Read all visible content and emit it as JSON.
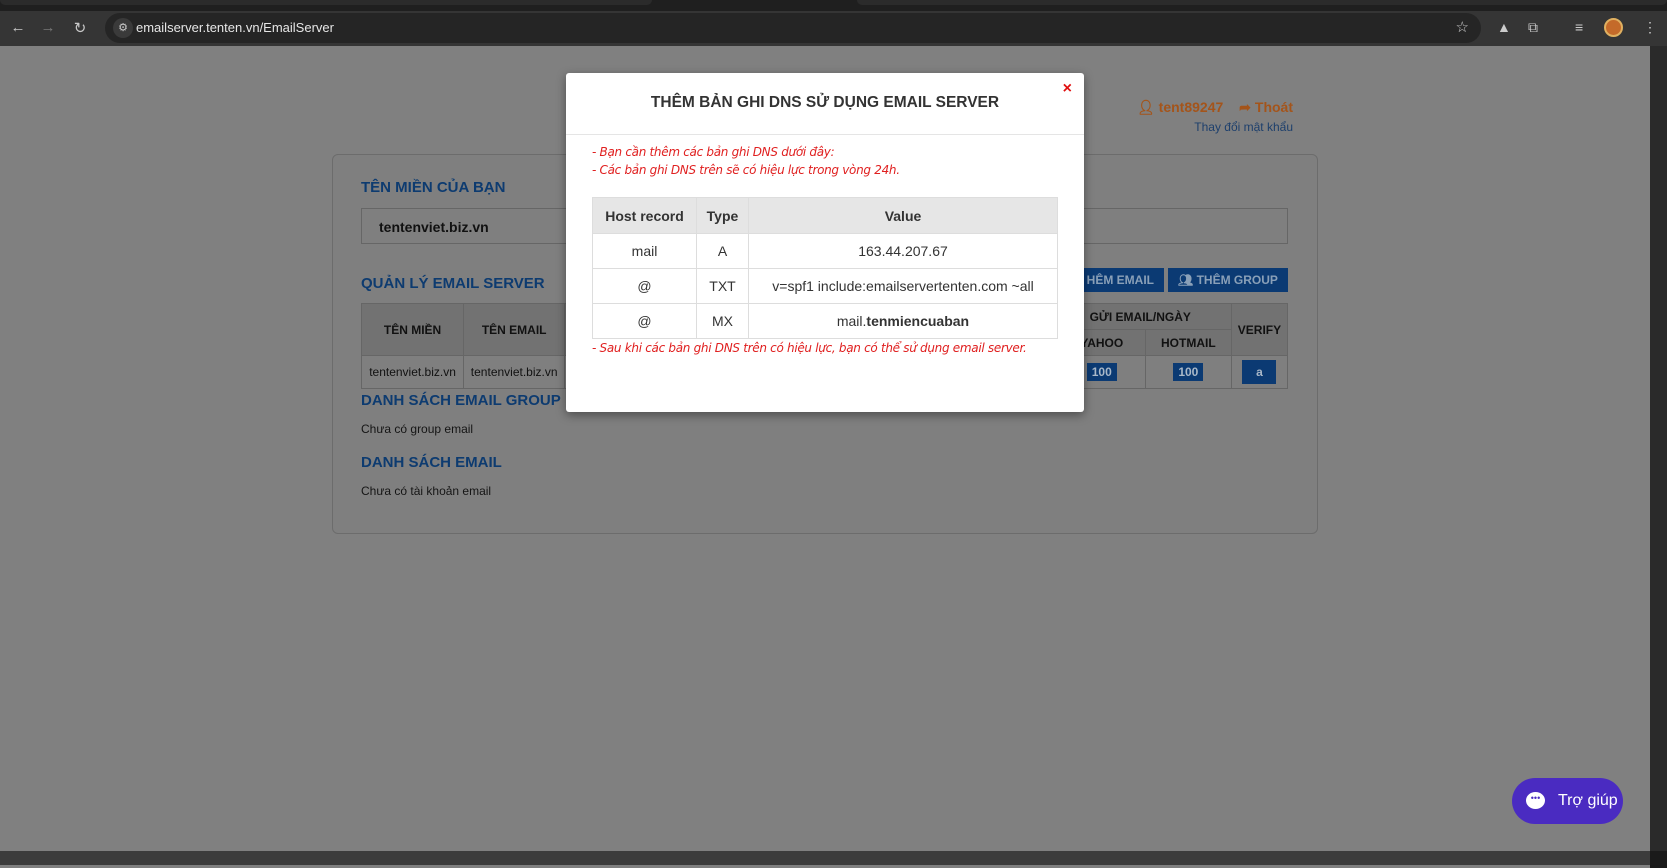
{
  "browser": {
    "url": "emailserver.tenten.vn/EmailServer"
  },
  "header": {
    "username": "tent89247",
    "logout": "Thoát",
    "change_password": "Thay đổi mật khẩu"
  },
  "domain_section": {
    "title": "TÊN MIỀN CỦA BẠN",
    "domain": "tentenviet.biz.vn"
  },
  "manage_section": {
    "title": "QUẢN LÝ EMAIL SERVER",
    "add_email_button": "HÊM EMAIL",
    "add_group_button": "THÊM GROUP",
    "columns": {
      "domain": "TÊN MIỀN",
      "email": "TÊN EMAIL",
      "send_per_day": "GỬI EMAIL/NGÀY",
      "yahoo": "YAHOO",
      "hotmail": "HOTMAIL",
      "verify": "VERIFY"
    },
    "row": {
      "domain": "tentenviet.biz.vn",
      "email": "tentenviet.biz.vn",
      "yahoo": "100",
      "hotmail": "100",
      "verify_icon": "amazon-icon",
      "verify_glyph": "a"
    }
  },
  "group_section": {
    "title": "DANH SÁCH EMAIL GROUP",
    "empty": "Chưa có group email"
  },
  "email_section": {
    "title": "DANH SÁCH EMAIL",
    "empty": "Chưa có tài khoản email"
  },
  "modal": {
    "title": "THÊM BẢN GHI DNS SỬ DỤNG EMAIL SERVER",
    "close": "×",
    "line1": "- Bạn cần thêm các bản ghi DNS dưới đây:",
    "line2": "- Các bản ghi DNS trên sẽ có hiệu lực trong vòng 24h.",
    "headers": [
      "Host record",
      "Type",
      "Value"
    ],
    "records": [
      {
        "host": "mail",
        "type": "A",
        "value": "163.44.207.67",
        "value_bold": ""
      },
      {
        "host": "@",
        "type": "TXT",
        "value": "v=spf1 include:emailservertenten.com ~all",
        "value_bold": ""
      },
      {
        "host": "@",
        "type": "MX",
        "value": "mail.",
        "value_bold": "tenmiencuaban"
      }
    ],
    "footer": "- Sau khi các bản ghi DNS trên có hiệu lực, bạn có thể sử dụng email server."
  },
  "help": {
    "label": "Trợ giúp"
  },
  "colors": {
    "help": "#4a2bc1",
    "modal_text": "#e02020",
    "button": "#0b3a73",
    "username": "#a4541a"
  }
}
